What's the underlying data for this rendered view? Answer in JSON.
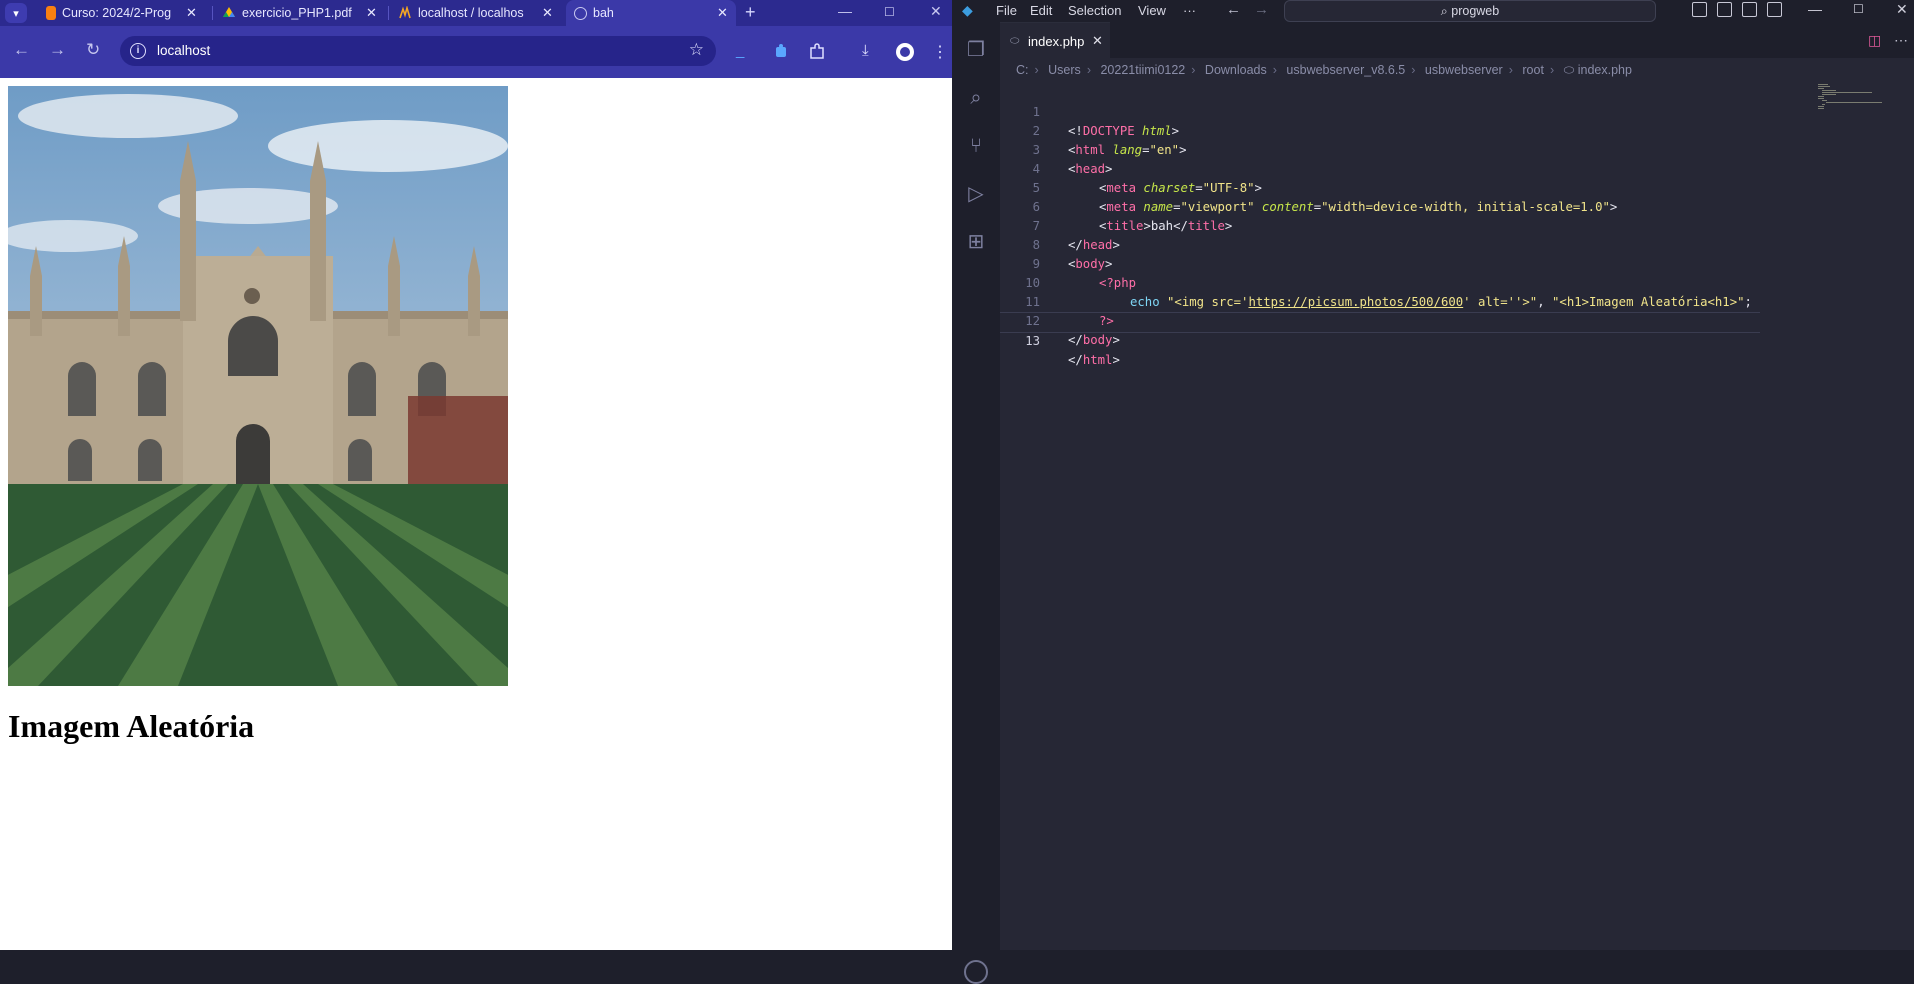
{
  "browser": {
    "tabs": [
      {
        "label": "Curso: 2024/2-Prog",
        "icon": "moodle-icon",
        "active": false
      },
      {
        "label": "exercicio_PHP1.pdf",
        "icon": "google-drive-icon",
        "active": false
      },
      {
        "label": "localhost / localhos",
        "icon": "phpmyadmin-icon",
        "active": false
      },
      {
        "label": "bah",
        "icon": "globe-icon",
        "active": true
      }
    ],
    "address": "localhost",
    "page": {
      "image_alt": "",
      "heading": "Imagem Aleatória"
    }
  },
  "vscode": {
    "menu": [
      "File",
      "Edit",
      "Selection",
      "View",
      "···"
    ],
    "command_center": "progweb",
    "open_tab": "index.php",
    "breadcrumb": [
      "C:",
      "Users",
      "20221tiimi0122",
      "Downloads",
      "usbwebserver_v8.6.5",
      "usbwebserver",
      "root",
      "index.php"
    ],
    "line_numbers": [
      "1",
      "2",
      "3",
      "4",
      "5",
      "6",
      "7",
      "8",
      "9",
      "10",
      "11",
      "12",
      "13"
    ],
    "current_line": 13,
    "code": {
      "l1_a": "<!",
      "l1_b": "DOCTYPE",
      "l1_c": " html",
      "l1_d": ">",
      "l2_a": "<",
      "l2_b": "html",
      "l2_c": " lang",
      "l2_d": "=",
      "l2_e": "\"en\"",
      "l2_f": ">",
      "l3_a": "<",
      "l3_b": "head",
      "l3_c": ">",
      "l4_a": "<",
      "l4_b": "meta",
      "l4_c": " charset",
      "l4_d": "=",
      "l4_e": "\"UTF-8\"",
      "l4_f": ">",
      "l5_a": "<",
      "l5_b": "meta",
      "l5_c": " name",
      "l5_d": "=",
      "l5_e": "\"viewport\"",
      "l5_f": " content",
      "l5_g": "=",
      "l5_h": "\"width=device-width, initial-scale=1.0\"",
      "l5_i": ">",
      "l6_a": "<",
      "l6_b": "title",
      "l6_c": ">",
      "l6_d": "bah",
      "l6_e": "</",
      "l6_f": "title",
      "l6_g": ">",
      "l7_a": "</",
      "l7_b": "head",
      "l7_c": ">",
      "l8_a": "<",
      "l8_b": "body",
      "l8_c": ">",
      "l9_a": "<?php",
      "l10_a": "echo",
      "l10_b": " \"<img src='",
      "l10_c": "https://picsum.photos/500/600",
      "l10_d": "' alt=''>\"",
      "l10_e": ", ",
      "l10_f": "\"<h1>Imagem Aleatória<h1>\"",
      "l10_g": ";",
      "l11_a": "?>",
      "l12_a": "</",
      "l12_b": "body",
      "l12_c": ">",
      "l13_a": "</",
      "l13_b": "html",
      "l13_c": ">"
    }
  }
}
